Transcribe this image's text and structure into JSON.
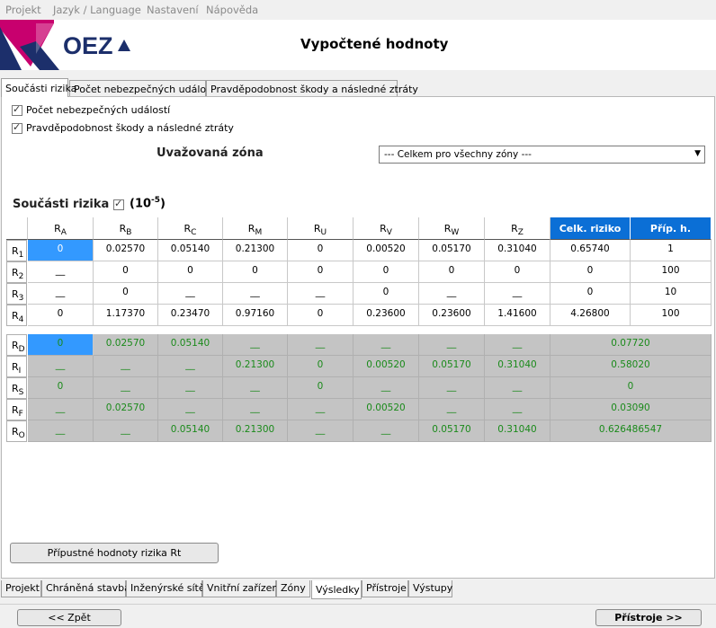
{
  "menu": [
    "Projekt",
    "Jazyk / Language",
    "Nastavení",
    "Nápověda"
  ],
  "logo_text": "OEZ",
  "page_title": "Vypočtené hodnoty",
  "top_tabs": [
    "Součásti rizika",
    "Počet nebezpečných událostí",
    "Pravděpodobnost škody a následné ztráty"
  ],
  "checkboxes": [
    "Počet nebezpečných událostí",
    "Pravděpodobnost škody a následné ztráty"
  ],
  "zone": {
    "label": "Uvažovaná zóna",
    "selected": "--- Celkem pro všechny zóny ---"
  },
  "section": {
    "title": "Součásti rizika",
    "unit_base": "(10",
    "unit_exp": "-5",
    "unit_close": ")"
  },
  "columns": [
    {
      "main": "R",
      "sub": "A"
    },
    {
      "main": "R",
      "sub": "B"
    },
    {
      "main": "R",
      "sub": "C"
    },
    {
      "main": "R",
      "sub": "M"
    },
    {
      "main": "R",
      "sub": "U"
    },
    {
      "main": "R",
      "sub": "V"
    },
    {
      "main": "R",
      "sub": "W"
    },
    {
      "main": "R",
      "sub": "Z"
    }
  ],
  "col_total": "Celk. riziko",
  "col_cases": "Příp. h.",
  "rows": [
    {
      "main": "R",
      "sub": "1",
      "cells": [
        "0",
        "0.02570",
        "0.05140",
        "0.21300",
        "0",
        "0.00520",
        "0.05170",
        "0.31040",
        "0.65740",
        "1"
      ]
    },
    {
      "main": "R",
      "sub": "2",
      "cells": [
        "__",
        "0",
        "0",
        "0",
        "0",
        "0",
        "0",
        "0",
        "0",
        "100"
      ]
    },
    {
      "main": "R",
      "sub": "3",
      "cells": [
        "__",
        "0",
        "__",
        "__",
        "__",
        "0",
        "__",
        "__",
        "0",
        "10"
      ]
    },
    {
      "main": "R",
      "sub": "4",
      "cells": [
        "0",
        "1.17370",
        "0.23470",
        "0.97160",
        "0",
        "0.23600",
        "0.23600",
        "1.41600",
        "4.26800",
        "100"
      ]
    }
  ],
  "grows": [
    {
      "main": "R",
      "sub": "D",
      "cells": [
        "0",
        "0.02570",
        "0.05140",
        "__",
        "__",
        "__",
        "__",
        "__"
      ],
      "total": "0.07720"
    },
    {
      "main": "R",
      "sub": "I",
      "cells": [
        "__",
        "__",
        "__",
        "0.21300",
        "0",
        "0.00520",
        "0.05170",
        "0.31040"
      ],
      "total": "0.58020"
    },
    {
      "main": "R",
      "sub": "S",
      "cells": [
        "0",
        "__",
        "__",
        "__",
        "0",
        "__",
        "__",
        "__"
      ],
      "total": "0"
    },
    {
      "main": "R",
      "sub": "F",
      "cells": [
        "__",
        "0.02570",
        "__",
        "__",
        "__",
        "0.00520",
        "__",
        "__"
      ],
      "total": "0.03090"
    },
    {
      "main": "R",
      "sub": "O",
      "cells": [
        "__",
        "__",
        "0.05140",
        "0.21300",
        "__",
        "__",
        "0.05170",
        "0.31040"
      ],
      "total": "0.626486547"
    }
  ],
  "rt_button": "Přípustné hodnoty rizika Rt",
  "bottom_tabs": [
    "Projekt",
    "Chráněná stavba",
    "Inženýrské sítě",
    "Vnitřní zařízení",
    "Zóny",
    "Výsledky",
    "Přístroje",
    "Výstupy"
  ],
  "back_button": "<< Zpět",
  "next_button": "Přístroje >>",
  "colors": {
    "header_blue": "#0b6fd6",
    "selected_cell": "#3399ff",
    "green_text": "#1a8a1a",
    "gray_cell": "#c4c4c4",
    "logo_magenta": "#c8006e",
    "logo_navy": "#1c2f6b"
  }
}
